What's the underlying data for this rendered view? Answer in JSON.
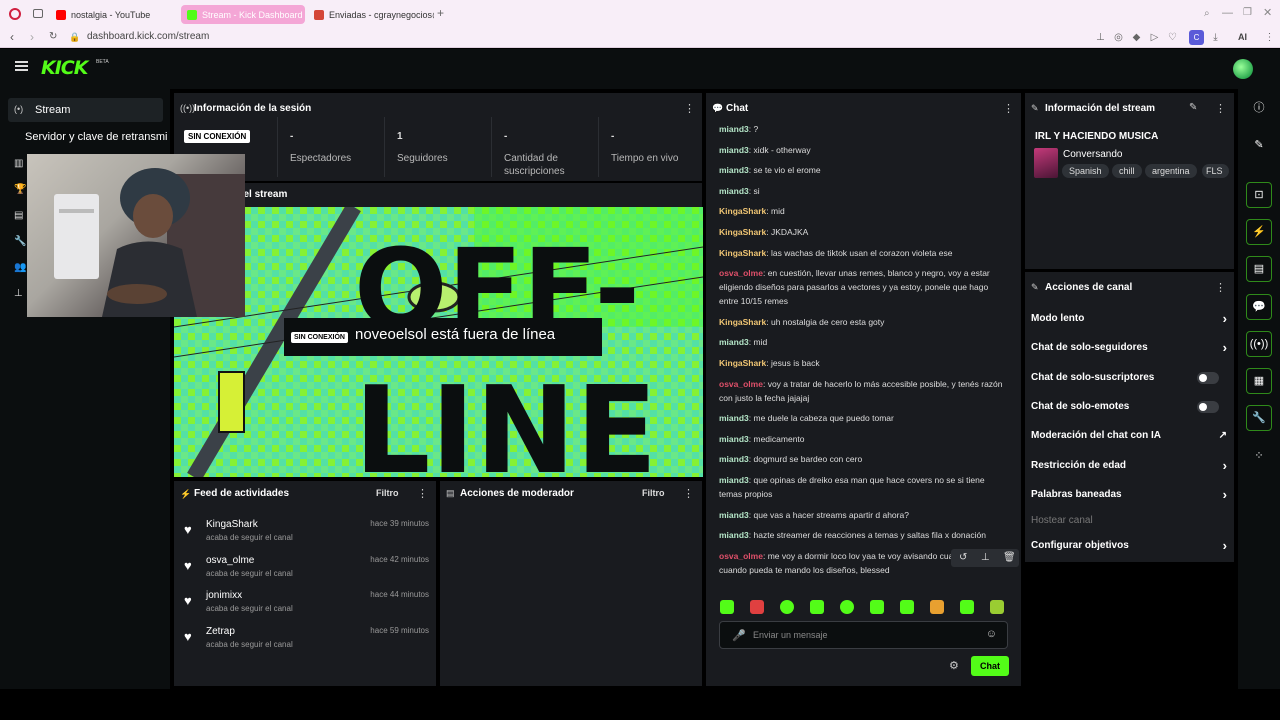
{
  "browser": {
    "tabs": [
      {
        "label": "nostalgia - YouTube",
        "color": "#ff0000"
      },
      {
        "label": "Stream - Kick Dashboard",
        "color": "#53fc18"
      },
      {
        "label": "Enviadas - cgraynegocios@",
        "color": "#d44638"
      }
    ],
    "url": "dashboard.kick.com/stream",
    "profile_letter": "C",
    "ai_label": "AI"
  },
  "header": {
    "logo": "KICK",
    "beta": "BETA"
  },
  "sidebar": {
    "stream_label": "Stream",
    "servidor_label": "Servidor y clave de retransmi"
  },
  "session": {
    "title": "Información de la sesión",
    "status_badge": "SIN CONEXIÓN",
    "stats": [
      {
        "value": "-",
        "label": "Espectadores"
      },
      {
        "value": "1",
        "label": "Seguidores"
      },
      {
        "value": "-",
        "label": "Cantidad de suscripciones"
      },
      {
        "value": "-",
        "label": "Tiempo en vivo"
      }
    ]
  },
  "preview": {
    "title_partial": "a del stream",
    "offline_badge": "SIN CONEXIÓN",
    "offline_text": "noveoelsol está fuera de línea",
    "art_text_1": "OFF-",
    "art_text_2": "LINE"
  },
  "feed": {
    "title": "Feed de actividades",
    "filter": "Filtro",
    "items": [
      {
        "name": "KingaShark",
        "sub": "acaba de seguir el canal",
        "time": "hace 39 minutos"
      },
      {
        "name": "osva_olme",
        "sub": "acaba de seguir el canal",
        "time": "hace 42 minutos"
      },
      {
        "name": "jonimixx",
        "sub": "acaba de seguir el canal",
        "time": "hace 44 minutos"
      },
      {
        "name": "Zetrap",
        "sub": "acaba de seguir el canal",
        "time": "hace 59 minutos"
      }
    ]
  },
  "mod": {
    "title": "Acciones de moderador",
    "filter": "Filtro"
  },
  "chat": {
    "title": "Chat",
    "messages": [
      {
        "user": "miand3",
        "color": "green",
        "text": "?"
      },
      {
        "user": "miand3",
        "color": "green",
        "text": "xidk - otherway"
      },
      {
        "user": "miand3",
        "color": "green",
        "text": "se te vio el erome"
      },
      {
        "user": "miand3",
        "color": "green",
        "text": "si"
      },
      {
        "user": "KingaShark",
        "color": "yellow",
        "text": "mid"
      },
      {
        "user": "KingaShark",
        "color": "yellow",
        "text": "JKDAJKA"
      },
      {
        "user": "KingaShark",
        "color": "yellow",
        "text": "las wachas de tiktok usan el corazon violeta ese"
      },
      {
        "user": "osva_olme",
        "color": "red",
        "text": "en cuestión, llevar unas remes, blanco y negro, voy a estar eligiendo diseños para pasarlos a vectores y ya estoy, ponele que hago entre 10/15 remes"
      },
      {
        "user": "KingaShark",
        "color": "yellow",
        "text": "uh nostalgia de cero esta goty"
      },
      {
        "user": "miand3",
        "color": "green",
        "text": "mid"
      },
      {
        "user": "KingaShark",
        "color": "yellow",
        "text": "jesus is back"
      },
      {
        "user": "osva_olme",
        "color": "red",
        "text": "voy a tratar de hacerlo lo más accesible posible, y tenés razón con justo la fecha jajajaj"
      },
      {
        "user": "miand3",
        "color": "green",
        "text": "me duele la cabeza que puedo tomar"
      },
      {
        "user": "miand3",
        "color": "green",
        "text": "medicamento"
      },
      {
        "user": "miand3",
        "color": "green",
        "text": "dogmurd se bardeo con cero"
      },
      {
        "user": "miand3",
        "color": "green",
        "text": "que opinas de dreiko esa man que hace covers no se si tiene temas propios"
      },
      {
        "user": "miand3",
        "color": "green",
        "text": "que vas a hacer streams apartir d ahora?"
      },
      {
        "user": "miand3",
        "color": "green",
        "text": "hazte streamer de reacciones a temas y saltas fila x donación"
      },
      {
        "user": "osva_olme",
        "color": "red",
        "text": "me voy a dormir loco lov yaa te voy avisando cualquier cosa, cuando pueda te mando los diseños, blessed"
      }
    ],
    "placeholder": "Enviar un mensaje",
    "send_label": "Chat"
  },
  "stream_info": {
    "title": "Información del stream",
    "stream_title": "IRL Y HACIENDO MUSICA",
    "category": "Conversando",
    "tags": [
      "Spanish",
      "chill",
      "argentina",
      "FLS"
    ]
  },
  "channel_actions": {
    "title": "Acciones de canal",
    "items": [
      {
        "label": "Modo lento",
        "kind": "arrow"
      },
      {
        "label": "Chat de solo-seguidores",
        "kind": "arrow"
      },
      {
        "label": "Chat de solo-suscriptores",
        "kind": "toggle"
      },
      {
        "label": "Chat de solo-emotes",
        "kind": "toggle"
      },
      {
        "label": "Moderación del chat con IA",
        "kind": "external"
      },
      {
        "label": "Restricción de edad",
        "kind": "arrow"
      },
      {
        "label": "Palabras baneadas",
        "kind": "arrow"
      },
      {
        "label": "Hostear canal",
        "kind": "disabled"
      },
      {
        "label": "Configurar objetivos",
        "kind": "arrow"
      }
    ]
  },
  "colors": {
    "accent": "#53fc18",
    "bg": "#0b0e0f",
    "panel": "#191b1f"
  }
}
